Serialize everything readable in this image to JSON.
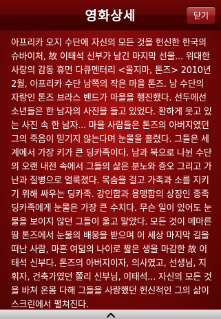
{
  "header": {
    "title": "영화상세",
    "close_label": "닫기"
  },
  "content": {
    "body": "아프리카 오지 수단에 자신의 모든 것을 헌신한 한국의 슈바이처, 故 이태석 신부가 남긴 마지막 선물... 위대한 사랑의 감동 휴먼 다큐멘터리 <울지마, 톤즈> 2010년 2월, 아프리카 수단 남쪽의 작은 마을 톤즈. 남 수단의 자랑인 톤즈 브라스 밴드가 마을을 행진했다. 선두에선 소년들은 한 남자의 사진을 들고 있었다. 환하게 웃고 있는 사진 속 한 남자... 마을 사람들은 톤즈의 아버지였던 그의 죽음이 믿기지 않는다며 눈물을 흘렸다. 그들은 세계에서 가장 키가 큰 딩카족이다. 남과 북으로 나뉜 수단의 오랜 내전 속에서 그들의 삶은 분노와 증오 그리고 가난과 질병으로 얼룩졌다. 목숨을 걸고 가족과 소를 지키기 위해 싸우는 딩카족. 강인함과 용맹함의 상징인 종족 딩카족에게 눈물은 가장 큰 수치다. 무슨 일이 있어도 눈물을 보이지 않던 그들이 울고 말았다. 모든 것이 메마른 땅 톤즈에서 눈물의 배웅을 받으며 이 세상 마지막 길을 떠난 사람, 마흔 여덟의 나이로 짧은 생을 마감한 故 이태석 신부다. 톤즈의 아버지이자, 의사였고, 선생님, 지휘자, 건축가였던 쫄리 신부님, 이태석... 자신의 모든 것을 바쳐 온몸 다해 그들을 사랑했던 헌신적인 그의 삶이 스크린에서 펼쳐진다."
  },
  "footer": {
    "handle_icon": "chevron-up-icon"
  },
  "colors": {
    "background": "#7c0808",
    "titlebar": "#4f0303",
    "text": "#ffffff",
    "footer": "#cccccc"
  }
}
